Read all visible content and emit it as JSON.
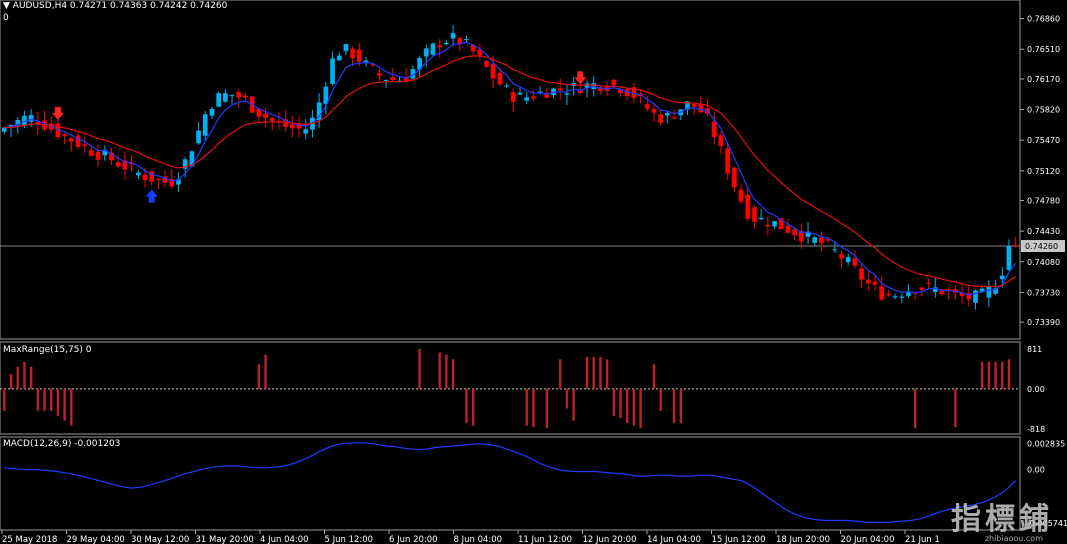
{
  "header": {
    "symbol_line": "AUDUSD,H4  0.74271 0.74363 0.74242 0.74260",
    "second_line": "0"
  },
  "watermark": {
    "text": "指標鋪",
    "sub": "zhibiaoou.com"
  },
  "colors": {
    "background": "#000000",
    "bull": "#00b0f0",
    "bear": "#ff0000",
    "ma_fast": "#1e3cff",
    "ma_slow": "#e01010",
    "grid": "#c0c0c0",
    "text": "#ffffff",
    "maxrange_bar": "#c0202a",
    "macd": "#1e3cff"
  },
  "chart_data": [
    {
      "type": "candlestick",
      "title": "AUDUSD,H4",
      "ylim": [
        0.7322,
        0.7705
      ],
      "y_ticks": [
        "0.76860",
        "0.76510",
        "0.76170",
        "0.75820",
        "0.75470",
        "0.75120",
        "0.74780",
        "0.74430",
        "0.74080",
        "0.73730",
        "0.73390"
      ],
      "current_price": "0.74260",
      "x_tick_labels": [
        "25 May 2018",
        "29 May 04:00",
        "30 May 12:00",
        "31 May 20:00",
        "4 Jun 04:00",
        "5 Jun 12:00",
        "6 Jun 20:00",
        "8 Jun 04:00",
        "11 Jun 12:00",
        "12 Jun 20:00",
        "14 Jun 04:00",
        "15 Jun 12:00",
        "18 Jun 20:00",
        "20 Jun 04:00",
        "21 Jun 1"
      ],
      "closes": [
        0.7556,
        0.7562,
        0.7566,
        0.757,
        0.7574,
        0.7572,
        0.7567,
        0.7561,
        0.7556,
        0.7551,
        0.7547,
        0.7542,
        0.7537,
        0.7533,
        0.753,
        0.7526,
        0.7521,
        0.7517,
        0.7512,
        0.7508,
        0.7505,
        0.7502,
        0.75,
        0.7498,
        0.7508,
        0.7522,
        0.7541,
        0.7561,
        0.7583,
        0.7594,
        0.7598,
        0.76,
        0.7597,
        0.7593,
        0.7585,
        0.7578,
        0.7572,
        0.7567,
        0.7564,
        0.7561,
        0.756,
        0.7559,
        0.757,
        0.7592,
        0.7621,
        0.7645,
        0.7651,
        0.7648,
        0.7642,
        0.7634,
        0.7627,
        0.7621,
        0.7618,
        0.7616,
        0.7617,
        0.7623,
        0.7634,
        0.7644,
        0.7652,
        0.7659,
        0.7662,
        0.7663,
        0.766,
        0.7652,
        0.7643,
        0.7632,
        0.7621,
        0.7612,
        0.7603,
        0.7597,
        0.7596,
        0.7597,
        0.76,
        0.7603,
        0.7604,
        0.7605,
        0.7606,
        0.7607,
        0.7609,
        0.761,
        0.7611,
        0.7611,
        0.761,
        0.7608,
        0.7604,
        0.7598,
        0.759,
        0.7581,
        0.7574,
        0.7572,
        0.7576,
        0.7583,
        0.7588,
        0.7586,
        0.7579,
        0.7567,
        0.7547,
        0.7524,
        0.7502,
        0.7483,
        0.7466,
        0.7458,
        0.7456,
        0.7454,
        0.7451,
        0.7447,
        0.7444,
        0.744,
        0.7436,
        0.7433,
        0.7429,
        0.7424,
        0.7418,
        0.7411,
        0.7402,
        0.7393,
        0.7384,
        0.7377,
        0.7372,
        0.737,
        0.7371,
        0.7375,
        0.7378,
        0.7379,
        0.7378,
        0.7377,
        0.7375,
        0.7372,
        0.7369,
        0.7367,
        0.7367,
        0.7368,
        0.7372,
        0.7381,
        0.7395,
        0.7426
      ],
      "series": [
        {
          "name": "MA fast",
          "color": "#1e3cff"
        },
        {
          "name": "MA slow",
          "color": "#e01010"
        }
      ],
      "arrows": [
        {
          "index": 8,
          "direction": "down",
          "color": "#ff2020"
        },
        {
          "index": 22,
          "direction": "up",
          "color": "#1040ff"
        },
        {
          "index": 86,
          "direction": "down",
          "color": "#ff2020"
        }
      ]
    },
    {
      "type": "bar",
      "title": "MaxRange(15,75) 0",
      "ylim": [
        -818,
        811
      ],
      "y_ticks": [
        "811",
        "0.00",
        "-818"
      ],
      "bars": [
        {
          "index": 0,
          "value": -450
        },
        {
          "index": 1,
          "value": 300
        },
        {
          "index": 2,
          "value": 450
        },
        {
          "index": 3,
          "value": 550
        },
        {
          "index": 4,
          "value": 450
        },
        {
          "index": 5,
          "value": -450
        },
        {
          "index": 6,
          "value": -450
        },
        {
          "index": 7,
          "value": -450
        },
        {
          "index": 8,
          "value": -550
        },
        {
          "index": 9,
          "value": -650
        },
        {
          "index": 10,
          "value": -750
        },
        {
          "index": 38,
          "value": 500
        },
        {
          "index": 39,
          "value": 700
        },
        {
          "index": 62,
          "value": 811
        },
        {
          "index": 65,
          "value": 740
        },
        {
          "index": 66,
          "value": 700
        },
        {
          "index": 67,
          "value": 600
        },
        {
          "index": 69,
          "value": -700
        },
        {
          "index": 70,
          "value": -750
        },
        {
          "index": 78,
          "value": -750
        },
        {
          "index": 79,
          "value": -780
        },
        {
          "index": 81,
          "value": -800
        },
        {
          "index": 83,
          "value": 600
        },
        {
          "index": 84,
          "value": -400
        },
        {
          "index": 85,
          "value": -650
        },
        {
          "index": 87,
          "value": 650
        },
        {
          "index": 88,
          "value": 650
        },
        {
          "index": 89,
          "value": 650
        },
        {
          "index": 90,
          "value": 600
        },
        {
          "index": 91,
          "value": -550
        },
        {
          "index": 92,
          "value": -600
        },
        {
          "index": 93,
          "value": -700
        },
        {
          "index": 94,
          "value": -750
        },
        {
          "index": 95,
          "value": -800
        },
        {
          "index": 97,
          "value": 500
        },
        {
          "index": 98,
          "value": -450
        },
        {
          "index": 100,
          "value": -700
        },
        {
          "index": 101,
          "value": -700
        },
        {
          "index": 136,
          "value": -800
        },
        {
          "index": 142,
          "value": -780
        },
        {
          "index": 146,
          "value": 550
        },
        {
          "index": 147,
          "value": 550
        },
        {
          "index": 148,
          "value": 550
        },
        {
          "index": 149,
          "value": 550
        },
        {
          "index": 150,
          "value": 600
        }
      ]
    },
    {
      "type": "line",
      "title": "MACD(12,26,9) -0.001203",
      "ylim": [
        -0.0062,
        0.0032
      ],
      "y_ticks": [
        "0.002835",
        "0.00",
        "-0.005741"
      ],
      "values": [
        0.0002,
        0.0001,
        0,
        0,
        -0.0001,
        -0.0002,
        -0.0004,
        -0.0006,
        -0.0009,
        -0.0012,
        -0.0015,
        -0.0018,
        -0.002,
        -0.0019,
        -0.0016,
        -0.0013,
        -0.0009,
        -0.0005,
        -0.0002,
        0.0001,
        0.0003,
        0.0004,
        0.0004,
        0.0003,
        0.0002,
        0.0002,
        0.0003,
        0.0005,
        0.0009,
        0.0014,
        0.002,
        0.0025,
        0.0028,
        0.0029,
        0.0029,
        0.0028,
        0.0026,
        0.0025,
        0.0023,
        0.0022,
        0.0022,
        0.0024,
        0.0025,
        0.0026,
        0.0027,
        0.0028,
        0.0027,
        0.0025,
        0.0021,
        0.0017,
        0.0012,
        0.0006,
        0.0002,
        -0.0001,
        -0.0002,
        -0.0002,
        -0.0002,
        -0.0003,
        -0.0004,
        -0.0005,
        -0.0007,
        -0.0007,
        -0.0006,
        -0.0006,
        -0.0007,
        -0.0007,
        -0.0006,
        -0.0006,
        -0.0008,
        -0.001,
        -0.0012,
        -0.0018,
        -0.0026,
        -0.0034,
        -0.0042,
        -0.0048,
        -0.0052,
        -0.0054,
        -0.0055,
        -0.0055,
        -0.0055,
        -0.0056,
        -0.0057,
        -0.0057,
        -0.0057,
        -0.0056,
        -0.0055,
        -0.0053,
        -0.0049,
        -0.0045,
        -0.0042,
        -0.004,
        -0.0038,
        -0.0035,
        -0.003,
        -0.0023,
        -0.0012
      ]
    }
  ]
}
